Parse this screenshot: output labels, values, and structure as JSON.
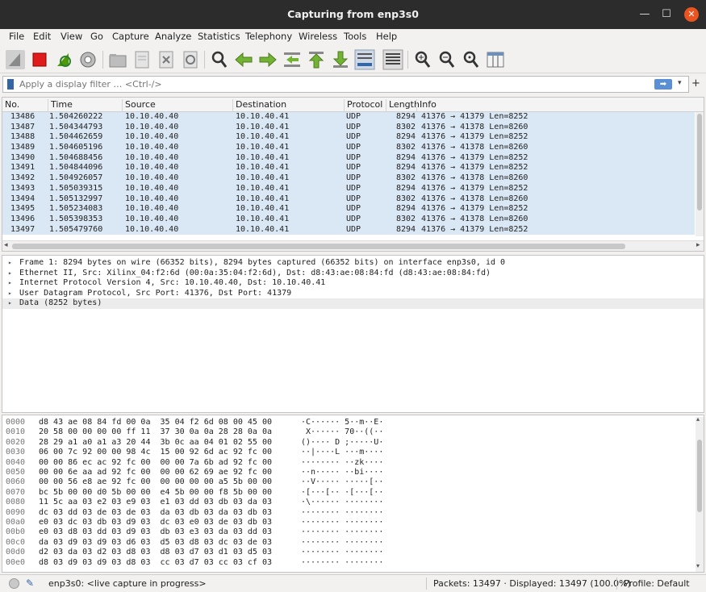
{
  "window": {
    "title": "Capturing from enp3s0"
  },
  "menu": [
    "File",
    "Edit",
    "View",
    "Go",
    "Capture",
    "Analyze",
    "Statistics",
    "Telephony",
    "Wireless",
    "Tools",
    "Help"
  ],
  "filter": {
    "placeholder": "Apply a display filter … <Ctrl-/>"
  },
  "packet_list": {
    "columns": [
      "No.",
      "Time",
      "Source",
      "Destination",
      "Protocol",
      "Length",
      "Info"
    ],
    "rows": [
      {
        "no": "13486",
        "time": "1.504260222",
        "src": "10.10.40.40",
        "dst": "10.10.40.41",
        "proto": "UDP",
        "len": "8294",
        "info": "41376 → 41379 Len=8252"
      },
      {
        "no": "13487",
        "time": "1.504344793",
        "src": "10.10.40.40",
        "dst": "10.10.40.41",
        "proto": "UDP",
        "len": "8302",
        "info": "41376 → 41378 Len=8260"
      },
      {
        "no": "13488",
        "time": "1.504462659",
        "src": "10.10.40.40",
        "dst": "10.10.40.41",
        "proto": "UDP",
        "len": "8294",
        "info": "41376 → 41379 Len=8252"
      },
      {
        "no": "13489",
        "time": "1.504605196",
        "src": "10.10.40.40",
        "dst": "10.10.40.41",
        "proto": "UDP",
        "len": "8302",
        "info": "41376 → 41378 Len=8260"
      },
      {
        "no": "13490",
        "time": "1.504688456",
        "src": "10.10.40.40",
        "dst": "10.10.40.41",
        "proto": "UDP",
        "len": "8294",
        "info": "41376 → 41379 Len=8252"
      },
      {
        "no": "13491",
        "time": "1.504844096",
        "src": "10.10.40.40",
        "dst": "10.10.40.41",
        "proto": "UDP",
        "len": "8294",
        "info": "41376 → 41379 Len=8252"
      },
      {
        "no": "13492",
        "time": "1.504926057",
        "src": "10.10.40.40",
        "dst": "10.10.40.41",
        "proto": "UDP",
        "len": "8302",
        "info": "41376 → 41378 Len=8260"
      },
      {
        "no": "13493",
        "time": "1.505039315",
        "src": "10.10.40.40",
        "dst": "10.10.40.41",
        "proto": "UDP",
        "len": "8294",
        "info": "41376 → 41379 Len=8252"
      },
      {
        "no": "13494",
        "time": "1.505132997",
        "src": "10.10.40.40",
        "dst": "10.10.40.41",
        "proto": "UDP",
        "len": "8302",
        "info": "41376 → 41378 Len=8260"
      },
      {
        "no": "13495",
        "time": "1.505234083",
        "src": "10.10.40.40",
        "dst": "10.10.40.41",
        "proto": "UDP",
        "len": "8294",
        "info": "41376 → 41379 Len=8252"
      },
      {
        "no": "13496",
        "time": "1.505398353",
        "src": "10.10.40.40",
        "dst": "10.10.40.41",
        "proto": "UDP",
        "len": "8302",
        "info": "41376 → 41378 Len=8260"
      },
      {
        "no": "13497",
        "time": "1.505479760",
        "src": "10.10.40.40",
        "dst": "10.10.40.41",
        "proto": "UDP",
        "len": "8294",
        "info": "41376 → 41379 Len=8252"
      }
    ]
  },
  "details": [
    "Frame 1: 8294 bytes on wire (66352 bits), 8294 bytes captured (66352 bits) on interface enp3s0, id 0",
    "Ethernet II, Src: Xilinx_04:f2:6d (00:0a:35:04:f2:6d), Dst: d8:43:ae:08:84:fd (d8:43:ae:08:84:fd)",
    "Internet Protocol Version 4, Src: 10.10.40.40, Dst: 10.10.40.41",
    "User Datagram Protocol, Src Port: 41376, Dst Port: 41379",
    "Data (8252 bytes)"
  ],
  "hex": [
    {
      "off": "0000",
      "hex": "d8 43 ae 08 84 fd 00 0a  35 04 f2 6d 08 00 45 00",
      "asc": "·C······ 5··m··E·"
    },
    {
      "off": "0010",
      "hex": "20 58 00 00 00 00 ff 11  37 30 0a 0a 28 28 0a 0a",
      "asc": " X······ 70··((··"
    },
    {
      "off": "0020",
      "hex": "28 29 a1 a0 a1 a3 20 44  3b 0c aa 04 01 02 55 00",
      "asc": "()···· D ;·····U·"
    },
    {
      "off": "0030",
      "hex": "06 00 7c 92 00 00 98 4c  15 00 92 6d ac 92 fc 00",
      "asc": "··|····L ···m····"
    },
    {
      "off": "0040",
      "hex": "00 00 86 ec ac 92 fc 00  00 00 7a 6b ad 92 fc 00",
      "asc": "········ ··zk····"
    },
    {
      "off": "0050",
      "hex": "00 00 6e aa ad 92 fc 00  00 00 62 69 ae 92 fc 00",
      "asc": "··n····· ··bi····"
    },
    {
      "off": "0060",
      "hex": "00 00 56 e8 ae 92 fc 00  00 00 00 00 a5 5b 00 00",
      "asc": "··V····· ·····[··"
    },
    {
      "off": "0070",
      "hex": "bc 5b 00 00 d0 5b 00 00  e4 5b 00 00 f8 5b 00 00",
      "asc": "·[···[·· ·[···[··"
    },
    {
      "off": "0080",
      "hex": "11 5c aa 03 e2 03 e9 03  e1 03 dd 03 db 03 da 03",
      "asc": "·\\······ ········"
    },
    {
      "off": "0090",
      "hex": "dc 03 dd 03 de 03 de 03  da 03 db 03 da 03 db 03",
      "asc": "········ ········"
    },
    {
      "off": "00a0",
      "hex": "e0 03 dc 03 db 03 d9 03  dc 03 e0 03 de 03 db 03",
      "asc": "········ ········"
    },
    {
      "off": "00b0",
      "hex": "e0 03 d8 03 dd 03 d9 03  db 03 e3 03 da 03 dd 03",
      "asc": "········ ········"
    },
    {
      "off": "00c0",
      "hex": "da 03 d9 03 d9 03 d6 03  d5 03 d8 03 dc 03 de 03",
      "asc": "········ ········"
    },
    {
      "off": "00d0",
      "hex": "d2 03 da 03 d2 03 d8 03  d8 03 d7 03 d1 03 d5 03",
      "asc": "········ ········"
    },
    {
      "off": "00e0",
      "hex": "d8 03 d9 03 d9 03 d8 03  cc 03 d7 03 cc 03 cf 03",
      "asc": "········ ········"
    }
  ],
  "status": {
    "capture": "enp3s0: <live capture in progress>",
    "packets": "Packets: 13497 · Displayed: 13497 (100.0%)",
    "profile": "Profile: Default"
  }
}
